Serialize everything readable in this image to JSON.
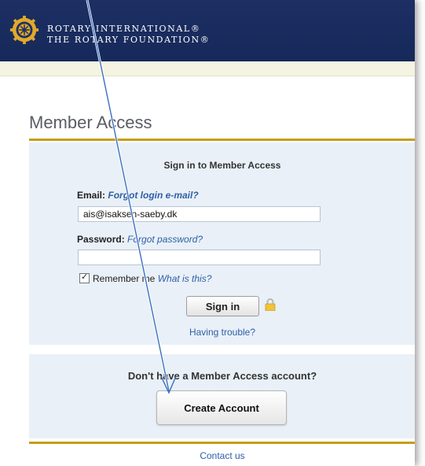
{
  "brand": {
    "line1": "ROTARY INTERNATIONAL®",
    "line2": "THE ROTARY FOUNDATION®",
    "logo_icon": "rotary-wheel-icon",
    "colors": {
      "header": "#1d2f63",
      "gold": "#c79d11",
      "link": "#2f5fa5"
    }
  },
  "page": {
    "title": "Member Access"
  },
  "signin": {
    "heading": "Sign in to Member Access",
    "email_label": "Email:",
    "email_help_link": "Forgot login e-mail?",
    "email_value": "ais@isaksen-saeby.dk",
    "password_label": "Password:",
    "password_help_link": "Forgot password?",
    "password_value": "",
    "remember_label": "Remember me",
    "remember_checked": true,
    "remember_help_link": "What is this?",
    "submit_label": "Sign in",
    "lock_icon": "lock-icon",
    "trouble_link": "Having trouble?"
  },
  "create": {
    "question": "Don't have a Member Access account?",
    "button_label": "Create Account"
  },
  "footer": {
    "contact_link": "Contact us"
  }
}
